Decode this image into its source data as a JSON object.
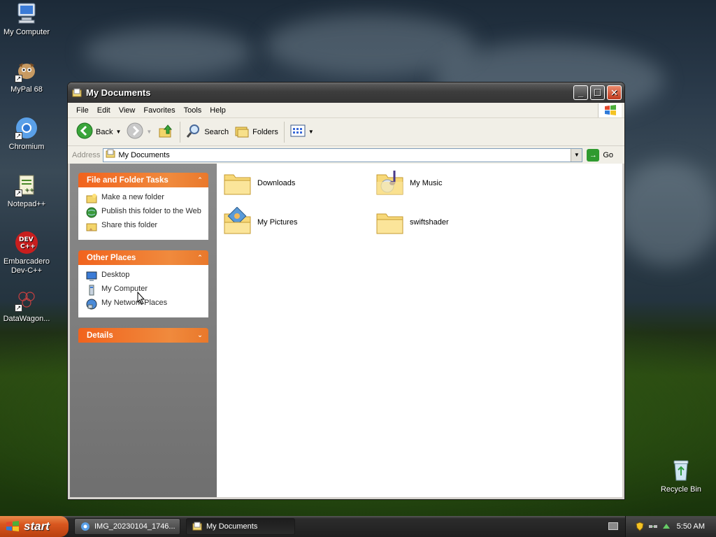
{
  "desktop": {
    "icons": [
      {
        "label": "My Computer"
      },
      {
        "label": "MyPal 68"
      },
      {
        "label": "Chromium"
      },
      {
        "label": "Notepad++"
      },
      {
        "label": "Embarcadero Dev-C++",
        "logo_text": "DEV C++"
      },
      {
        "label": "DataWagon..."
      },
      {
        "label": "Recycle Bin"
      }
    ]
  },
  "window": {
    "title": "My Documents",
    "menu": [
      "File",
      "Edit",
      "View",
      "Favorites",
      "Tools",
      "Help"
    ],
    "toolbar": {
      "back_label": "Back",
      "search_label": "Search",
      "folders_label": "Folders"
    },
    "address": {
      "label": "Address",
      "value": "My Documents",
      "go_label": "Go"
    },
    "tasks_pane": {
      "file_folder_tasks": {
        "title": "File and Folder Tasks",
        "items": [
          "Make a new folder",
          "Publish this folder to the Web",
          "Share this folder"
        ]
      },
      "other_places": {
        "title": "Other Places",
        "items": [
          "Desktop",
          "My Computer",
          "My Network Places"
        ]
      },
      "details": {
        "title": "Details"
      }
    },
    "files": [
      {
        "name": "Downloads",
        "icon": "folder-icon"
      },
      {
        "name": "My Music",
        "icon": "music-folder-icon"
      },
      {
        "name": "My Pictures",
        "icon": "pictures-folder-icon"
      },
      {
        "name": "swiftshader",
        "icon": "folder-icon"
      }
    ]
  },
  "taskbar": {
    "start_label": "start",
    "buttons": [
      {
        "label": "IMG_20230104_1746..."
      },
      {
        "label": "My Documents"
      }
    ],
    "clock": "5:50 AM"
  }
}
